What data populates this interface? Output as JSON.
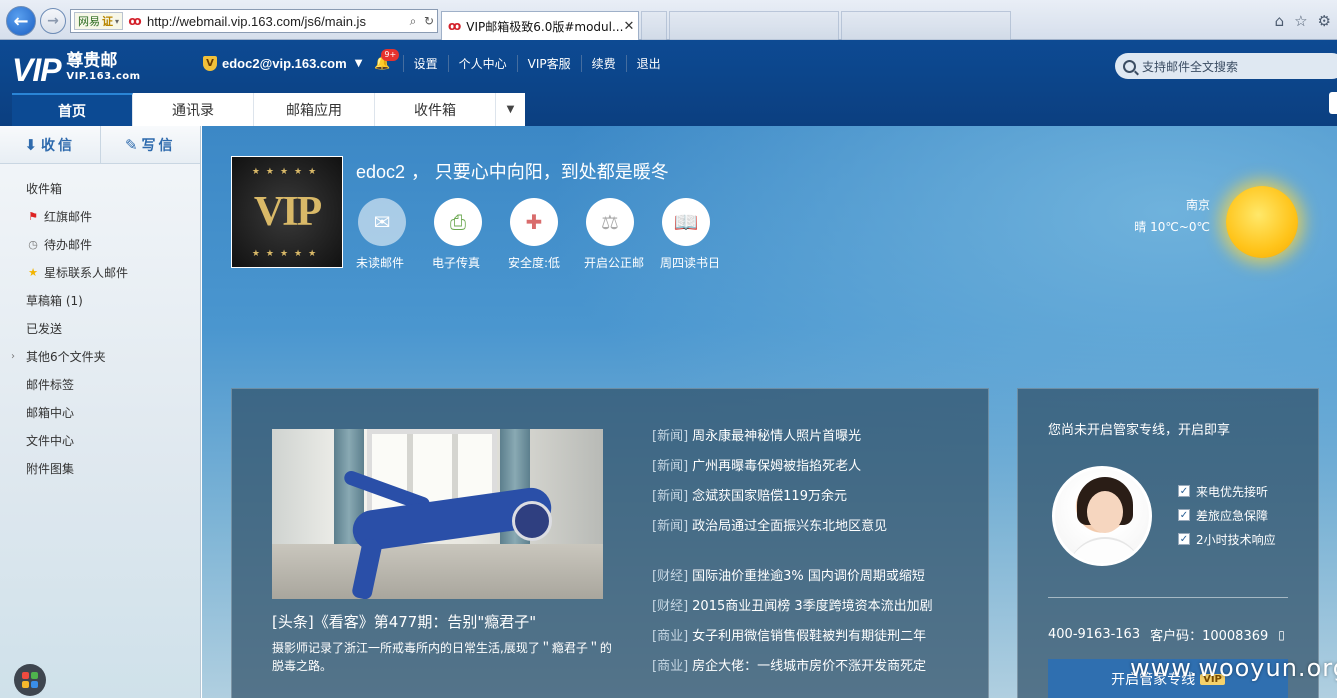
{
  "browser": {
    "url": "http://webmail.vip.163.com/js6/main.js",
    "site_badge": "网易",
    "cert_badge": "证",
    "active_tab_title": "VIP邮箱极致6.0版#modul...",
    "tab_close": "✕"
  },
  "header": {
    "logo_vip": "VIP",
    "logo_cn": "尊贵邮",
    "logo_domain": "VIP.163.com",
    "account": "edoc2@vip.163.com",
    "notification_count": "9+",
    "links": [
      "设置",
      "个人中心",
      "VIP客服",
      "续费",
      "退出"
    ],
    "search_placeholder": "支持邮件全文搜索",
    "tabs": [
      "首页",
      "通讯录",
      "邮箱应用",
      "收件箱"
    ]
  },
  "sidebar": {
    "receive_label": "收信",
    "compose_label": "写信",
    "folders": [
      {
        "label": "收件箱",
        "icon": ""
      },
      {
        "label": "红旗邮件",
        "icon": "red-flag-icon"
      },
      {
        "label": "待办邮件",
        "icon": "clock-icon"
      },
      {
        "label": "星标联系人邮件",
        "icon": "star-icon"
      },
      {
        "label": "草稿箱 (1)",
        "icon": ""
      },
      {
        "label": "已发送",
        "icon": ""
      },
      {
        "label": "其他6个文件夹",
        "icon": "expand-arrow-icon"
      },
      {
        "label": "邮件标签",
        "icon": ""
      },
      {
        "label": "邮箱中心",
        "icon": ""
      },
      {
        "label": "文件中心",
        "icon": ""
      },
      {
        "label": "附件图集",
        "icon": ""
      }
    ]
  },
  "home": {
    "username": "edoc2",
    "motto": "，  只要心中向阳，到处都是暖冬",
    "quick_actions": [
      {
        "label": "未读邮件",
        "icon": "envelope-icon"
      },
      {
        "label": "电子传真",
        "icon": "fax-icon"
      },
      {
        "label": "安全度:低",
        "icon": "first-aid-kit-icon"
      },
      {
        "label": "开启公正邮",
        "icon": "gavel-icon"
      },
      {
        "label": "周四读书日",
        "icon": "book-icon"
      }
    ],
    "weather": {
      "city": "南京",
      "condition": "晴  10℃~0℃"
    },
    "news": {
      "headline": "[头条]《看客》第477期：告别\"瘾君子\"",
      "summary": "摄影师记录了浙江一所戒毒所内的日常生活,展现了＂瘾君子＂的脱毒之路。",
      "items": [
        {
          "cat": "[新闻]",
          "title": "周永康最神秘情人照片首曝光"
        },
        {
          "cat": "[新闻]",
          "title": "广州再曝毒保姆被指掐死老人"
        },
        {
          "cat": "[新闻]",
          "title": "念斌获国家赔偿119万余元"
        },
        {
          "cat": "[新闻]",
          "title": "政治局通过全面振兴东北地区意见"
        },
        {
          "cat": "[财经]",
          "title": "国际油价重挫逾3% 国内调价周期或缩短"
        },
        {
          "cat": "[财经]",
          "title": "2015商业丑闻榜 3季度跨境资本流出加剧"
        },
        {
          "cat": "[商业]",
          "title": "女子利用微信销售假鞋被判有期徒刑二年"
        },
        {
          "cat": "[商业]",
          "title": "房企大佬：一线城市房价不涨开发商死定"
        }
      ],
      "carousel_progress": 0.33
    },
    "service": {
      "title": "您尚未开启管家专线，开启即享",
      "benefits": [
        "来电优先接听",
        "差旅应急保障",
        "2小时技术响应"
      ],
      "hotline": "400-9163-163",
      "customer_code": "客户码：10008369",
      "button_label": "开启管家专线",
      "button_badge": "VIP"
    }
  },
  "watermark": "www.wooyun.org",
  "colors": {
    "header_bg": "#0d4a93",
    "accent_blue": "#2e6aad",
    "panel_bg": "#315068",
    "sun": "#ffc41a"
  }
}
